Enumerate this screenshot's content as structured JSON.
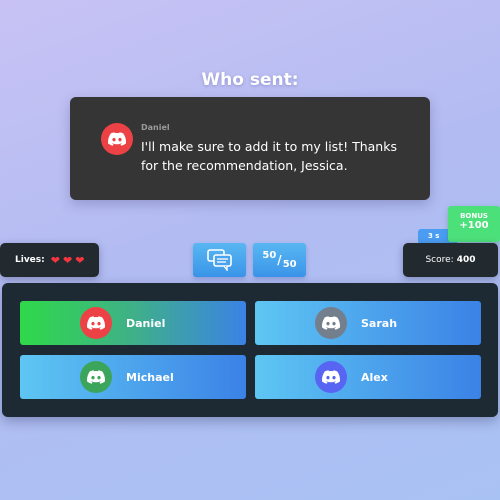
{
  "title": "Who sent:",
  "message": {
    "author": "Daniel",
    "text": "I'll make sure to add it to my list! Thanks for the recommendation, Jessica.",
    "avatar_color": "#ed4245",
    "avatar_icon": "discord-icon"
  },
  "hud": {
    "lives_label": "Lives:",
    "lives": 3,
    "score_label": "Score:",
    "score_value": "400"
  },
  "powerups": {
    "chat_icon": "chat-bubbles-icon",
    "fifty_left": "50",
    "fifty_right": "50"
  },
  "bonus": {
    "label": "BONUS",
    "value": "+100",
    "back_text": "3 s"
  },
  "answers": [
    {
      "name": "Daniel",
      "color": "#ed4245",
      "highlight": "correct"
    },
    {
      "name": "Sarah",
      "color": "#747f8d"
    },
    {
      "name": "Michael",
      "color": "#3ba55c"
    },
    {
      "name": "Alex",
      "color": "#5865f2"
    }
  ]
}
